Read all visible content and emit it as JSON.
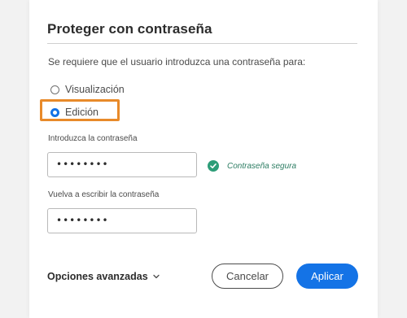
{
  "dialog": {
    "title": "Proteger con contraseña",
    "instruction": "Se requiere que el usuario introduzca una contraseña para:",
    "options": [
      {
        "label": "Visualización",
        "selected": false
      },
      {
        "label": "Edición",
        "selected": true
      }
    ],
    "password_label": "Introduzca la contraseña",
    "password_value": "••••••••",
    "strength_text": "Contraseña segura",
    "confirm_label": "Vuelva a escribir la contraseña",
    "confirm_value": "••••••••",
    "advanced_label": "Opciones avanzadas",
    "cancel_label": "Cancelar",
    "apply_label": "Aplicar"
  },
  "icons": {
    "strength": "check-circle-icon",
    "advanced": "chevron-down-icon"
  },
  "colors": {
    "accent": "#1473e6",
    "highlight": "#e88a2a",
    "success": "#2d9d78"
  }
}
